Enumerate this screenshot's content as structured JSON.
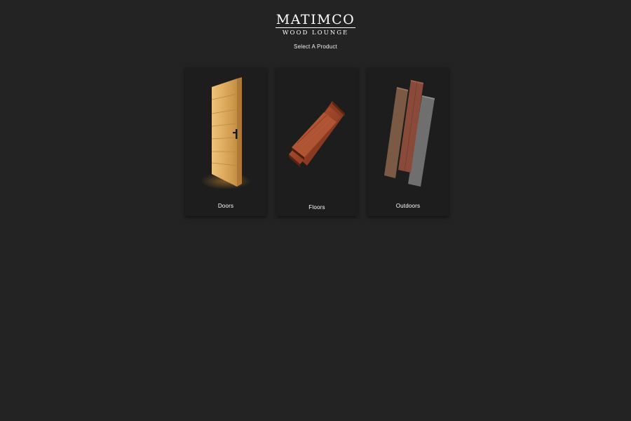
{
  "logo": {
    "main": "MATIMCO",
    "sub": "WOOD LOUNGE"
  },
  "subtitle": "Select A Product",
  "products": [
    {
      "label": "Doors",
      "icon": "wooden-door-icon"
    },
    {
      "label": "Floors",
      "icon": "floor-planks-icon"
    },
    {
      "label": "Outdoors",
      "icon": "decking-boards-icon"
    }
  ],
  "colors": {
    "background": "#232323",
    "card": "#1d1d1d",
    "text": "#ffffff",
    "door_wood": "#d6a55c",
    "floor_wood": "#9a4428",
    "deck_brown": "#7a5a45",
    "deck_red": "#8a4a3a",
    "deck_gray": "#6f6f6f"
  }
}
